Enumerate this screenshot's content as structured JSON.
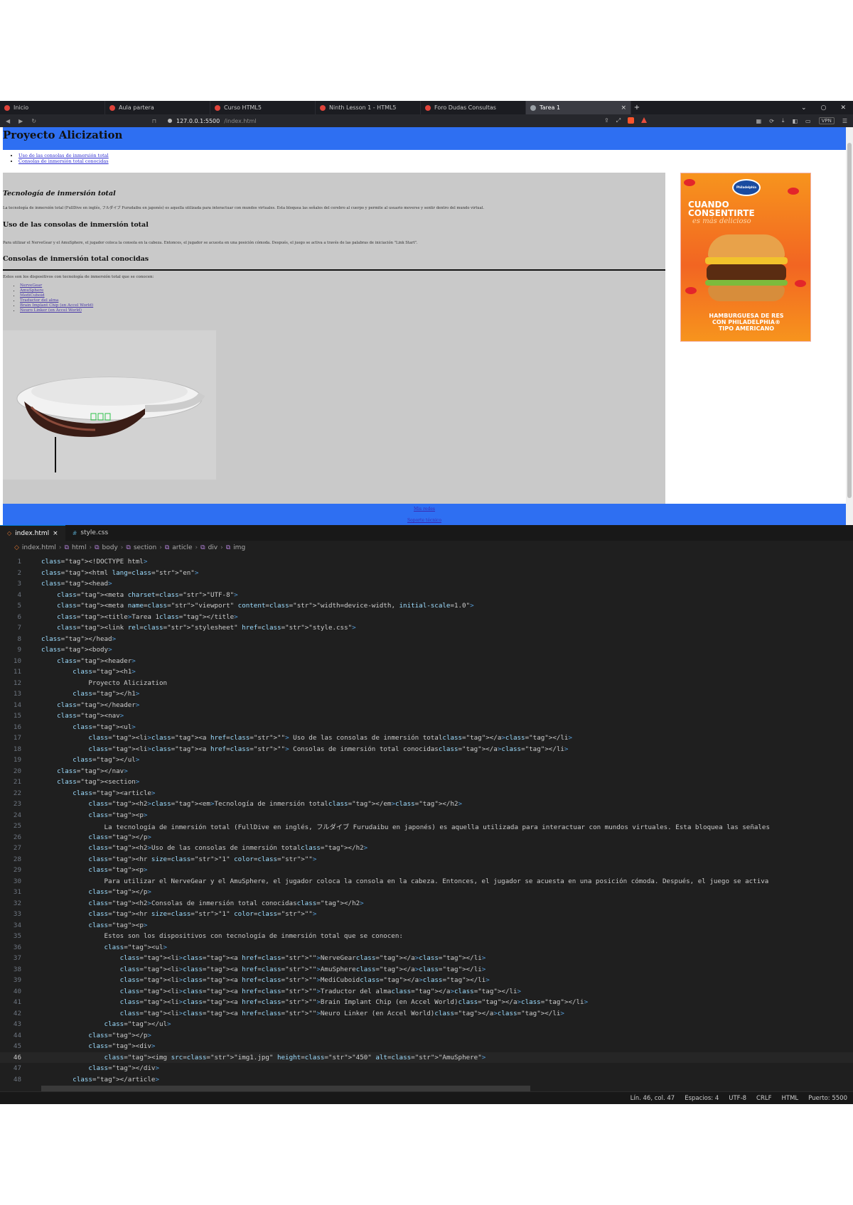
{
  "browser": {
    "tabs": [
      {
        "label": "Inicio",
        "active": false
      },
      {
        "label": "Aula partera",
        "active": false
      },
      {
        "label": "Curso HTML5",
        "active": false
      },
      {
        "label": "Ninth Lesson 1 - HTML5",
        "active": false
      },
      {
        "label": "Foro Dudas Consultas",
        "active": false
      },
      {
        "label": "Tarea 1",
        "active": true
      }
    ],
    "new_tab": "+",
    "url_host": "127.0.0.1:5500",
    "url_path": "/index.html",
    "vpn_label": "VPN",
    "colors": {
      "brave": "#fb542b"
    }
  },
  "page": {
    "title": "Proyecto Alicization",
    "nav": [
      "Uso de las consolas de inmersión total",
      "Consolas de inmersión total conocidas"
    ],
    "h2_tech": "Tecnología de inmersión total",
    "p_tech": "La tecnología de inmersión total (FullDive en inglés, フルダイブ Furudaibu en japonés) es aquella utilizada para interactuar con mundos virtuales. Esta bloquea las señales del cerebro al cuerpo y permite al usuario moverse y sentir dentro del mundo virtual.",
    "h2_use": "Uso de las consolas de inmersión total",
    "p_use": "Para utilizar el NerveGear y el AmuSphere, el jugador coloca la consola en la cabeza. Entonces, el jugador se acuesta en una posición cómoda. Después, el juego se activa a través de las palabras de iniciación \"Link Start\".",
    "h2_known": "Consolas de inmersión total conocidas",
    "p_known": "Estos son los dispositivos con tecnología de inmersión total que se conocen:",
    "devices": [
      "NerveGear",
      "AmuSphere",
      "MediCuboid",
      "Traductor del alma",
      "Brain Implant Chip (en Accel World)",
      "Neuro Linker (en Accel World)"
    ],
    "ad": {
      "brand": "Philadelphia",
      "line1": "CUANDO",
      "line2": "CONSENTIRTE",
      "line3": "es más delicioso",
      "bottom1": "HAMBURGUESA DE RES",
      "bottom2": "CON PHILADELPHIA®",
      "bottom3": "TIPO AMERICANO"
    },
    "footer_links": [
      "Mis redes",
      "Soporte técnico"
    ],
    "colors": {
      "header": "#2e6ff2",
      "section": "#c9c9c9"
    }
  },
  "editor": {
    "tabs": [
      {
        "label": "index.html",
        "active": true,
        "close": "×"
      },
      {
        "label": "style.css",
        "active": false
      }
    ],
    "breadcrumbs": [
      "index.html",
      "html",
      "body",
      "section",
      "article",
      "div",
      "img"
    ],
    "current_line": 46,
    "lines": [
      "<!DOCTYPE html>",
      "<html lang=\"en\">",
      "<head>",
      "    <meta charset=\"UTF-8\">",
      "    <meta name=\"viewport\" content=\"width=device-width, initial-scale=1.0\">",
      "    <title>Tarea 1</title>",
      "    <link rel=\"stylesheet\" href=\"style.css\">",
      "</head>",
      "<body>",
      "    <header>",
      "        <h1>",
      "            Proyecto Alicization",
      "        </h1>",
      "    </header>",
      "    <nav>",
      "        <ul>",
      "            <li><a href=\"\"> Uso de las consolas de inmersión total</a></li>",
      "            <li><a href=\"\"> Consolas de inmersión total conocidas</a></li>",
      "        </ul>",
      "    </nav>",
      "    <section>",
      "        <article>",
      "            <h2><em>Tecnología de inmersión total</em></h2>",
      "            <p>",
      "                La tecnología de inmersión total (FullDive en inglés, フルダイブ Furudaibu en japonés) es aquella utilizada para interactuar con mundos virtuales. Esta bloquea las señales",
      "            </p>",
      "            <h2>Uso de las consolas de inmersión total</h2>",
      "            <hr size=\"1\" color=\"\">",
      "            <p>",
      "                Para utilizar el NerveGear y el AmuSphere, el jugador coloca la consola en la cabeza. Entonces, el jugador se acuesta en una posición cómoda. Después, el juego se activa",
      "            </p>",
      "            <h2>Consolas de inmersión total conocidas</h2>",
      "            <hr size=\"1\" color=\"\">",
      "            <p>",
      "                Estos son los dispositivos con tecnología de inmersión total que se conocen:",
      "                <ul>",
      "                    <li><a href=\"\">NerveGear</a></li>",
      "                    <li><a href=\"\">AmuSphere</a></li>",
      "                    <li><a href=\"\">MediCuboid</a></li>",
      "                    <li><a href=\"\">Traductor del alma</a></li>",
      "                    <li><a href=\"\">Brain Implant Chip (en Accel World)</a></li>",
      "                    <li><a href=\"\">Neuro Linker (en Accel World)</a></li>",
      "                </ul>",
      "            </p>",
      "            <div>",
      "                <img src=\"img1.jpg\" height=\"450\" alt=\"AmuSphere\">",
      "            </div>",
      "        </article>"
    ],
    "status": [
      "Lín. 46, col. 47",
      "Espacios: 4",
      "UTF-8",
      "CRLF",
      "HTML",
      "Puerto: 5500"
    ]
  }
}
